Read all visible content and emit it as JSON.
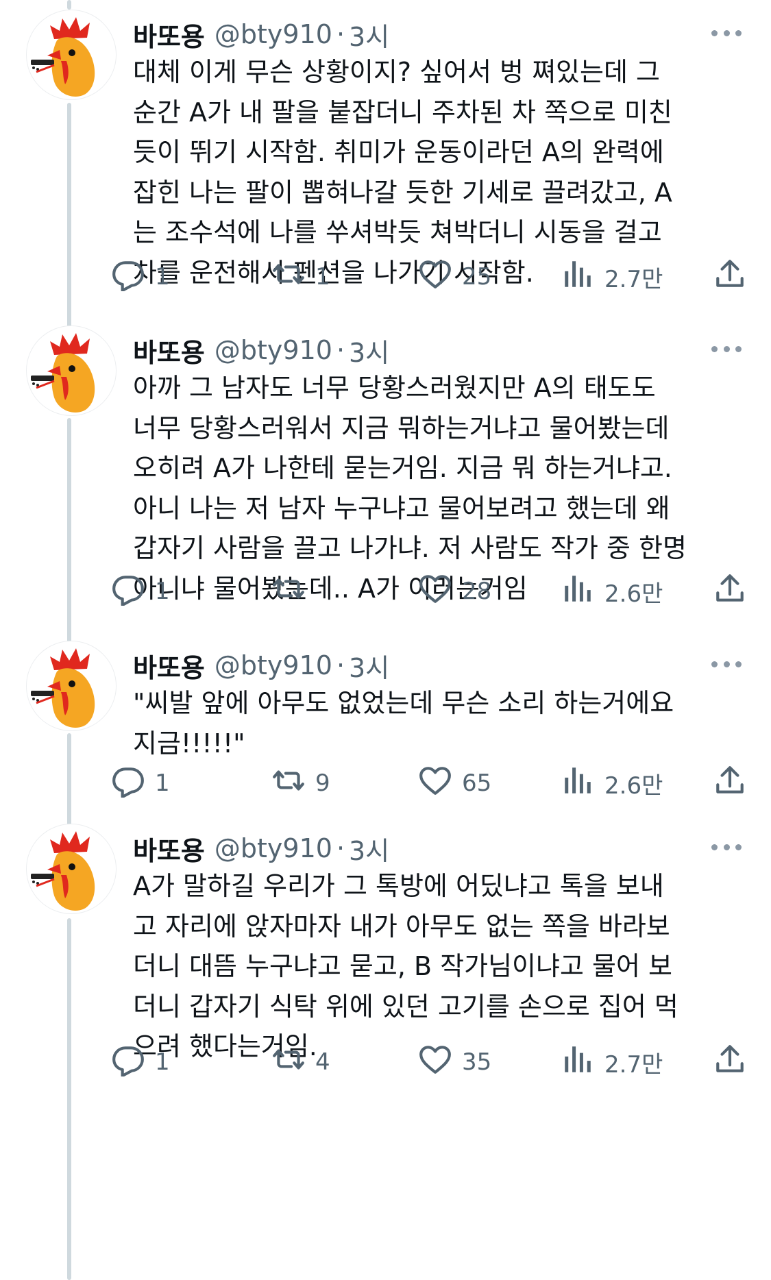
{
  "tweets": [
    {
      "name": "바또용",
      "handle": "@bty910",
      "separator": "·",
      "time": "3시",
      "lines": [
        "대체 이게 무슨 상황이지? 싶어서 벙 쪄있는데 그",
        "순간 A가 내 팔을 붙잡더니 주차된 차 쪽으로 미친",
        "듯이 뛰기 시작함. 취미가 운동이라던 A의 완력에",
        "잡힌 나는 팔이 뽑혀나갈 듯한 기세로 끌려갔고, A",
        "는 조수석에 나를 쑤셔박듯 쳐박더니 시동을 걸고",
        "차를 운전해서 펜션을 나가기 시작함."
      ],
      "reply_count": "1",
      "retweet_count": "1",
      "like_count": "25",
      "view_count": "2.7만"
    },
    {
      "name": "바또용",
      "handle": "@bty910",
      "separator": "·",
      "time": "3시",
      "lines": [
        "아까 그 남자도 너무 당황스러웠지만 A의 태도도",
        "너무 당황스러워서 지금 뭐하는거냐고 물어봤는데",
        "오히려 A가 나한테 묻는거임. 지금 뭐 하는거냐고.",
        "아니 나는 저 남자 누구냐고 물어보려고 했는데 왜",
        "갑자기 사람을 끌고 나가냐. 저 사람도 작가 중 한명",
        "아니냐 물어봤는데.. A가 이러는거임"
      ],
      "reply_count": "1",
      "retweet_count": "",
      "like_count": "28",
      "view_count": "2.6만"
    },
    {
      "name": "바또용",
      "handle": "@bty910",
      "separator": "·",
      "time": "3시",
      "lines": [
        "\"씨발 앞에 아무도 없었는데 무슨 소리 하는거에요",
        "지금!!!!!\""
      ],
      "reply_count": "1",
      "retweet_count": "9",
      "like_count": "65",
      "view_count": "2.6만"
    },
    {
      "name": "바또용",
      "handle": "@bty910",
      "separator": "·",
      "time": "3시",
      "lines": [
        "A가 말하길 우리가 그 톡방에 어딨냐고 톡을 보내",
        "고 자리에 앉자마자 내가 아무도 없는 쪽을 바라보",
        "더니 대뜸 누구냐고 묻고, B 작가님이냐고 물어 보",
        "더니 갑자기 식탁 위에 있던 고기를 손으로 집어 먹",
        "으려 했다는거임."
      ],
      "reply_count": "1",
      "retweet_count": "4",
      "like_count": "35",
      "view_count": "2.7만"
    }
  ],
  "icons": {
    "reply": "reply-icon",
    "retweet": "retweet-icon",
    "like": "heart-icon",
    "views": "views-icon",
    "share": "share-icon",
    "more": "more-icon",
    "avatar": "rooster-avatar"
  },
  "colors": {
    "text": "#0f1419",
    "secondary": "#536471",
    "thread_line": "#cfd9de",
    "avatar_red": "#e0281e",
    "avatar_orange": "#f5a623"
  }
}
